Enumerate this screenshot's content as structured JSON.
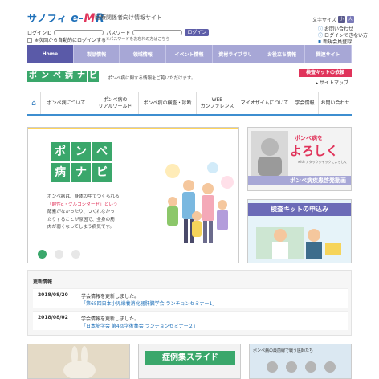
{
  "header": {
    "logo_text": "サノフィ",
    "logo_emr": "e-MR",
    "site_desc": "医療関係者向け情報サイト",
    "font_size_label": "文字サイズ",
    "font_small": "小",
    "font_large": "大",
    "inquiry": "お問い合わせ",
    "login_help": "ログインできない方",
    "register": "新規会員登録",
    "login_id_label": "ログインID",
    "password_label": "パスワード",
    "login_button": "ログイン",
    "auto_login": "※次回から自動的にログインする",
    "forgot": "※パスワードをお忘れの方はこちら"
  },
  "nav": [
    "Home",
    "製品情報",
    "領域情報",
    "イベント情報",
    "資材ライブラリ",
    "お役立ち情報",
    "関連サイト"
  ],
  "sub": {
    "brand": [
      "ポ",
      "ン",
      "ペ",
      "病",
      "ナ",
      "ビ"
    ],
    "desc": "ポンペ病に関する情報をご覧いただけます。",
    "kit_button": "検査キットの依頼",
    "sitemap": "サイトマップ"
  },
  "categories": [
    "ポンペ病について",
    "ポンペ病の\nリアルワールド",
    "ポンペ病の検査・診断",
    "WEB\nカンファレンス",
    "マイオザイムについて",
    "学会情報",
    "お問い合わせ"
  ],
  "hero": {
    "logo": [
      "ポ",
      "ン",
      "ペ",
      "病",
      "ナ",
      "ビ"
    ],
    "text_1": "ポンペ病は、身体の中でつくられる",
    "text_2": "「酸性α・グルコシダーゼ」という",
    "text_3": "酵素がなかったり、つくれなかっ",
    "text_4": "たりすることが原因で、全身の筋",
    "text_5": "肉が弱くなってしまう病気です。"
  },
  "side1": {
    "line1": "ポンペ病を",
    "line2": "よろしく",
    "line3": "with アタックジャックによろしく",
    "bar": "ポンペ病疾患啓発動画"
  },
  "side2": {
    "title": "検査キットの申込み"
  },
  "news": {
    "title": "更新情報",
    "items": [
      {
        "date": "2018/08/20",
        "text": "学会情報を更新しました。",
        "link": "「第65回日本小児栄養消化器肝臓学会 ランチョンセミナー1」"
      },
      {
        "date": "2018/08/02",
        "text": "学会情報を更新しました。",
        "link": "「日本筋学会 第4回学術集会 ランチョンセミナー２」"
      }
    ]
  },
  "thumbs": {
    "case_slides": "症例集スライド",
    "latest": "ポンペ病の最前線で戦う医師たち"
  },
  "colors": {
    "green": "#3aa76b",
    "purple": "#5a5aa8",
    "pink": "#e0335a",
    "blue": "#1d6fb8"
  }
}
